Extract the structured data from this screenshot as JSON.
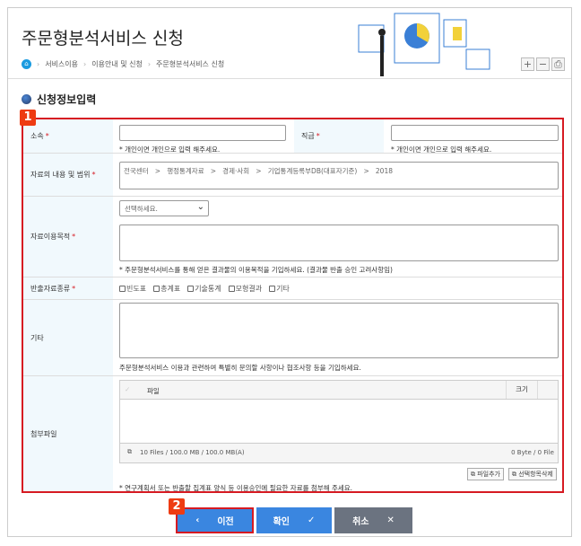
{
  "header": {
    "title": "주문형분석서비스 신청",
    "breadcrumb": [
      "서비스이용",
      "이용안내 및 신청",
      "주문형분석서비스 신청"
    ]
  },
  "toolbar": {
    "zoom_in": "+",
    "zoom_out": "−",
    "print": "⎙"
  },
  "section": {
    "title": "신청정보입력"
  },
  "badges": {
    "one": "1",
    "two": "2"
  },
  "form": {
    "affiliation": {
      "label": "소속",
      "required": "*",
      "value": "",
      "note": "* 개인이면 개인으로 입력 해주세요."
    },
    "rank": {
      "label": "직급",
      "required": "*",
      "value": "",
      "note": "* 개인이면 개인으로 입력 해주세요."
    },
    "scope": {
      "label": "자료의 내용 및 범위",
      "required": "*",
      "value": "전국센터   >   행정통계자료   >   경제·사회   >   기업통계등록부DB(대표자기준)   >   2018"
    },
    "purpose": {
      "label": "자료이용목적",
      "required": "*",
      "select": "선택하세요.",
      "note": "* 주문형분석서비스를 통해 얻은 결과물의 이용목적을 기입하세요. (결과물 반출 승인 고려사항임)"
    },
    "export_type": {
      "label": "반출자료종류",
      "required": "*",
      "options": [
        "빈도표",
        "총계표",
        "기술통계",
        "모형결과",
        "기타"
      ]
    },
    "etc": {
      "label": "기타",
      "note": "주문형분석서비스 이용과 관련하여 특별히 문의할 사항이나 협조사항 등을 기입하세요."
    },
    "attach": {
      "label": "첨부파일",
      "col_file": "파일",
      "col_size": "크기",
      "limit": "10 Files / 100.0 MB / 100.0 MB(A)",
      "total": "0 Byte / 0 File",
      "add": "파일추가",
      "delete": "선택항목삭제",
      "note": "* 연구계획서 또는 반출할 집계표 양식 등 이용승인에 필요한 자료를 첨부해 주세요."
    }
  },
  "buttons": {
    "prev": "이전",
    "confirm": "확인",
    "cancel": "취소"
  },
  "colors": {
    "primary": "#3a86e0",
    "cancel": "#6b7380",
    "highlight": "#d61a22",
    "badge": "#ee3b12"
  }
}
